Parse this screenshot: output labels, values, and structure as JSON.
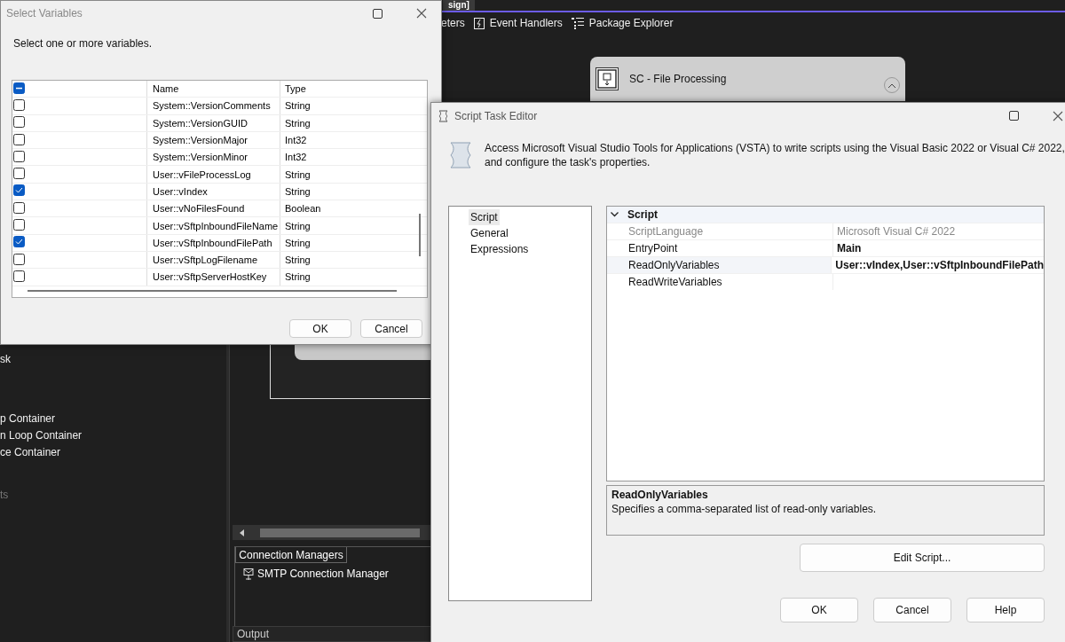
{
  "ide": {
    "tab_title": "sign]",
    "toolbar": [
      "eters",
      "Event Handlers",
      "Package Explorer"
    ],
    "container": {
      "title": "SC - File Processing",
      "expanded": true
    },
    "toolbox": [
      {
        "label": "sk",
        "disabled": false
      },
      {
        "label": "p Container",
        "disabled": false
      },
      {
        "label": "n Loop Container",
        "disabled": false
      },
      {
        "label": "ce Container",
        "disabled": false
      },
      {
        "label": "ts",
        "disabled": true
      }
    ],
    "connection_managers": {
      "tab": "Connection Managers",
      "items": [
        "SMTP Connection Manager"
      ]
    },
    "output_title": "Output"
  },
  "select_variables": {
    "title": "Select Variables",
    "prompt": "Select one or more variables.",
    "header_checkbox": {
      "indeterminate": true
    },
    "columns": [
      "Name",
      "Type"
    ],
    "rows": [
      {
        "name": "System::VersionComments",
        "type": "String",
        "checked": false
      },
      {
        "name": "System::VersionGUID",
        "type": "String",
        "checked": false
      },
      {
        "name": "System::VersionMajor",
        "type": "Int32",
        "checked": false
      },
      {
        "name": "System::VersionMinor",
        "type": "Int32",
        "checked": false
      },
      {
        "name": "User::vFileProcessLog",
        "type": "String",
        "checked": false
      },
      {
        "name": "User::vIndex",
        "type": "String",
        "checked": true
      },
      {
        "name": "User::vNoFilesFound",
        "type": "Boolean",
        "checked": false
      },
      {
        "name": "User::vSftpInboundFileName",
        "type": "String",
        "checked": false
      },
      {
        "name": "User::vSftpInboundFilePath",
        "type": "String",
        "checked": true
      },
      {
        "name": "User::vSftpLogFilename",
        "type": "String",
        "checked": false
      },
      {
        "name": "User::vSftpServerHostKey",
        "type": "String",
        "checked": false
      }
    ],
    "buttons": [
      "OK",
      "Cancel"
    ]
  },
  "script_task_editor": {
    "title": "Script Task Editor",
    "description": "Access Microsoft Visual Studio Tools for Applications (VSTA) to write scripts using the Visual Basic 2022 or Visual C# 2022, and configure the task's properties.",
    "nav": [
      {
        "label": "Script",
        "selected": true
      },
      {
        "label": "General",
        "selected": false
      },
      {
        "label": "Expressions",
        "selected": false
      }
    ],
    "category": {
      "label": "Script",
      "expanded": true
    },
    "properties": [
      {
        "name": "ScriptLanguage",
        "value": "Microsoft Visual C# 2022",
        "disabled": true,
        "modified": false,
        "selected": false
      },
      {
        "name": "EntryPoint",
        "value": "Main",
        "disabled": false,
        "modified": true,
        "selected": false
      },
      {
        "name": "ReadOnlyVariables",
        "value": "User::vIndex,User::vSftpInboundFilePath",
        "disabled": false,
        "modified": true,
        "selected": true
      },
      {
        "name": "ReadWriteVariables",
        "disabled": false,
        "modified": false,
        "selected": false
      }
    ],
    "help": {
      "title": "ReadOnlyVariables",
      "text": "Specifies a comma-separated list of read-only variables."
    },
    "edit_button": "Edit Script...",
    "buttons": [
      "OK",
      "Cancel",
      "Help"
    ]
  }
}
